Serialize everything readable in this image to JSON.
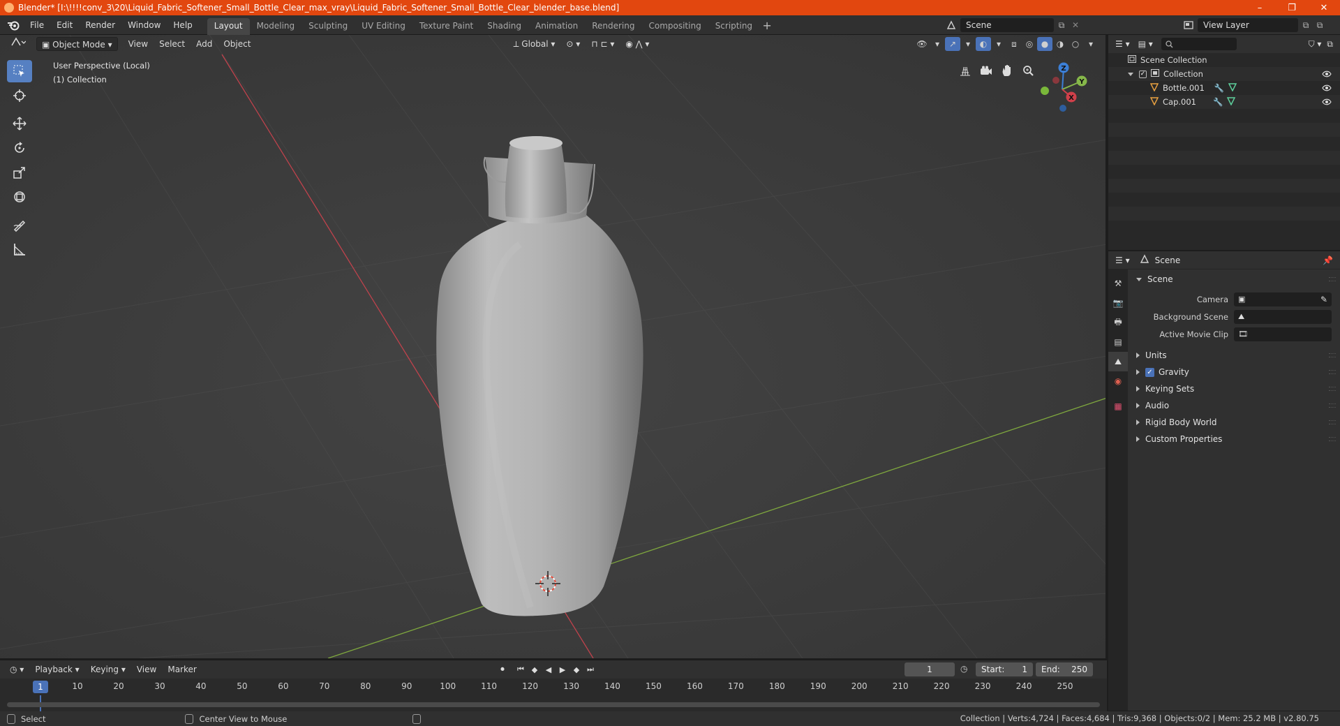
{
  "titlebar": {
    "title": "Blender* [I:\\!!!!conv_3\\20\\Liquid_Fabric_Softener_Small_Bottle_Clear_max_vray\\Liquid_Fabric_Softener_Small_Bottle_Clear_blender_base.blend]",
    "minimize": "–",
    "maximize": "❐",
    "close": "✕"
  },
  "menu": [
    "File",
    "Edit",
    "Render",
    "Window",
    "Help"
  ],
  "workspaces": [
    "Layout",
    "Modeling",
    "Sculpting",
    "UV Editing",
    "Texture Paint",
    "Shading",
    "Animation",
    "Rendering",
    "Compositing",
    "Scripting"
  ],
  "active_workspace": "Layout",
  "scene_name": "Scene",
  "view_layer": "View Layer",
  "viewport": {
    "mode": "Object Mode",
    "menus": [
      "View",
      "Select",
      "Add",
      "Object"
    ],
    "orientation": "Global",
    "info_line1": "User Perspective (Local)",
    "info_line2": "(1) Collection",
    "gizmo_axes": {
      "z": "Z",
      "y": "Y",
      "x": "X"
    }
  },
  "tools": [
    "select-box",
    "cursor",
    "move",
    "rotate",
    "scale",
    "transform",
    "annotate",
    "measure"
  ],
  "outliner": {
    "root": "Scene Collection",
    "collection": "Collection",
    "objects": [
      "Bottle.001",
      "Cap.001"
    ]
  },
  "properties": {
    "header_title": "Scene",
    "section_title": "Scene",
    "fields": [
      {
        "label": "Camera"
      },
      {
        "label": "Background Scene"
      },
      {
        "label": "Active Movie Clip"
      }
    ],
    "panels": [
      "Units",
      "Gravity",
      "Keying Sets",
      "Audio",
      "Rigid Body World",
      "Custom Properties"
    ],
    "gravity_checked": true
  },
  "timeline": {
    "menus": [
      "Playback",
      "Keying",
      "View",
      "Marker"
    ],
    "current_frame": "1",
    "start_label": "Start:",
    "start": "1",
    "end_label": "End:",
    "end": "250",
    "ticks": [
      "10",
      "20",
      "30",
      "40",
      "50",
      "60",
      "70",
      "80",
      "90",
      "100",
      "110",
      "120",
      "130",
      "140",
      "150",
      "160",
      "170",
      "180",
      "190",
      "200",
      "210",
      "220",
      "230",
      "240",
      "250"
    ],
    "cursor_label": "1"
  },
  "statusbar": {
    "select": "Select",
    "center_view": "Center View to Mouse",
    "stats": "Collection | Verts:4,724 | Faces:4,684 | Tris:9,368 | Objects:0/2 | Mem: 25.2 MB | v2.80.75"
  },
  "colors": {
    "titlebar": "#e2470f",
    "accent_blue": "#4a72b8",
    "x_axis": "#d0404a",
    "y_axis": "#86b84a",
    "z_axis": "#3c7fd6"
  }
}
